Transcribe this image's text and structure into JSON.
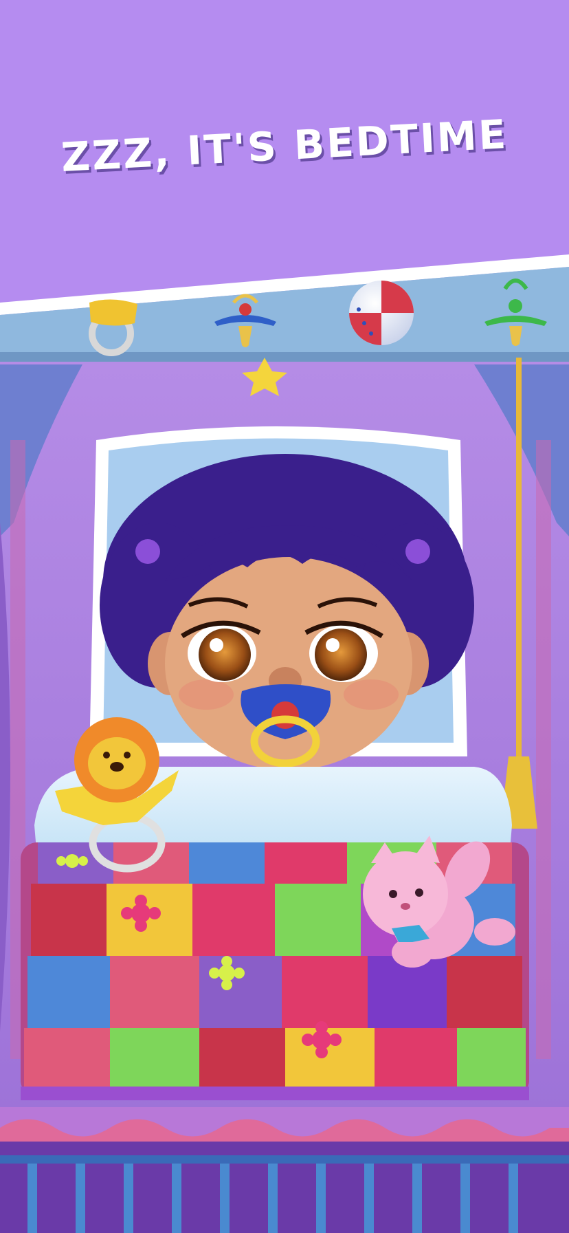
{
  "banner": {
    "headline": "ZZZ, IT'S BEDTIME",
    "background_color": "#b58cf0"
  },
  "scene": {
    "items": {
      "baby": "sleeping-baby",
      "pacifier": "blue-pacifier-icon",
      "mobile_toys": [
        "rattle-ring-icon",
        "pacifier-icon",
        "beach-ball-icon",
        "green-pacifier-icon",
        "star-icon"
      ],
      "lion_toy": "lion-teether-icon",
      "cat_toy": "pink-cat-plush-icon",
      "quilt": "patchwork-quilt",
      "bell_rope": "bell-pull-rope"
    },
    "colors": {
      "wall": "#a67fd9",
      "pillow": "#a9cdef",
      "hair": "#3a1f8c",
      "skin": "#e3a77f",
      "crib_top": "#8fb8de",
      "curtain": "#6e7fd0"
    }
  }
}
